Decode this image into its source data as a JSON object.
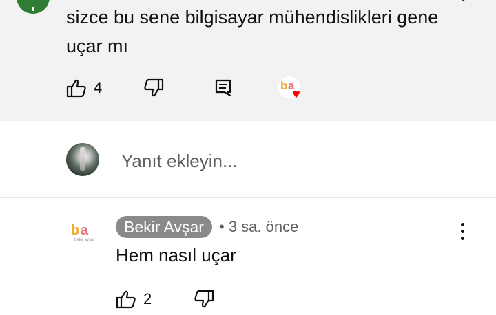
{
  "comment": {
    "text": "sizce bu sene bilgisayar mühendislikleri gene uçar mı",
    "like_count": "4",
    "icons": {
      "like": "thumb-up-icon",
      "dislike": "thumb-down-icon",
      "reply": "comment-icon",
      "creator_heart": "heart-icon"
    }
  },
  "reply_box": {
    "placeholder": "Yanıt ekleyin..."
  },
  "reply": {
    "author": "Bekir Avşar",
    "meta": "• 3 sa. önce",
    "text": "Hem nasıl uçar",
    "like_count": "2",
    "avatar_logo": {
      "b": "b",
      "a": "a",
      "sub": "bekir avşar"
    }
  },
  "colors": {
    "top_background": "#f2f2f2",
    "heart": "#ff0000",
    "author_badge": "#8a8a8a",
    "secondary_text": "#606060"
  }
}
